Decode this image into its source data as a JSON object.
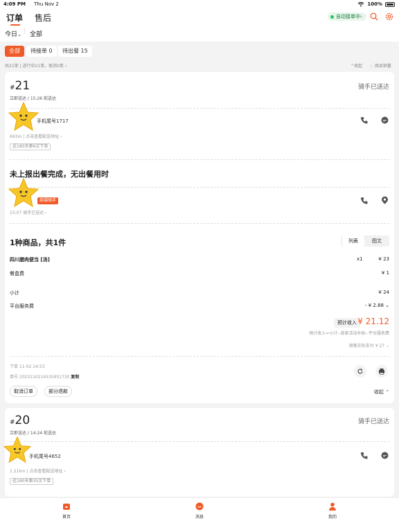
{
  "status_bar": {
    "time": "4:09 PM",
    "date": "Thu Nov 2",
    "battery": "100%"
  },
  "header": {
    "tabs": [
      "订单",
      "售后"
    ],
    "auto_accept": "自动接单中",
    "auto_accept_arrow": "›"
  },
  "filter": {
    "day": "今日",
    "day_arrow": "⌄",
    "scope": "全部"
  },
  "chips": [
    "全部",
    "待接单 0",
    "待出餐 15"
  ],
  "summary": {
    "left": "共21单 | 进行中21单，取消0单 ›",
    "collapse": "⌃收起",
    "sales": "⋮ 商品销量"
  },
  "order1": {
    "hash": "#",
    "number": "21",
    "delivery": "立即送达 / 15:26 前送达",
    "status": "骑手已送达",
    "phone_tail": "手机尾号1717",
    "distance": "693m | 点击查看配送地址 ›",
    "history": "近180天第6次下单",
    "notice": "未上报出餐完成，无出餐用时",
    "rider_tag": "商福骑手",
    "rider_time": "15:07  骑手已送达 ›",
    "items_title": "1种商品，共1件",
    "view_list": "列表",
    "view_image": "图文",
    "items": [
      {
        "name": "四川腊肉便当 [汤]",
        "qty": "x1",
        "price": "¥ 23"
      }
    ],
    "box_fee_label": "餐盒费",
    "box_fee": "¥ 1",
    "subtotal_label": "小计",
    "subtotal": "¥ 24",
    "platform_label": "平台服务费",
    "platform_fee": "- ¥ 2.88 ⌄",
    "est_label": "预计收入",
    "est_value": "¥ 21.12",
    "est_formula": "预计收入=小计--商家活动补贴--平台服务费",
    "customer_paid": "顾客实际支付 ¥ 27 ⌄",
    "placed": "下单 11-02 14:53",
    "order_no": "单号 2023110214535951730",
    "copy": "复制",
    "cancel_btn": "取消订单",
    "refund_btn": "部分退款",
    "collapse": "收起 ⌃"
  },
  "order2": {
    "hash": "#",
    "number": "20",
    "delivery": "立即送达 / 14:24 前送达",
    "status": "骑手已送达",
    "phone_tail": "手机尾号4652",
    "distance": "1.21km | 点击查看配送地址 ›",
    "history": "近180天第35次下单"
  },
  "tabbar": [
    "首页",
    "消息",
    "我的"
  ],
  "colors": {
    "accent": "#f05a28",
    "green": "#2bbf62"
  }
}
